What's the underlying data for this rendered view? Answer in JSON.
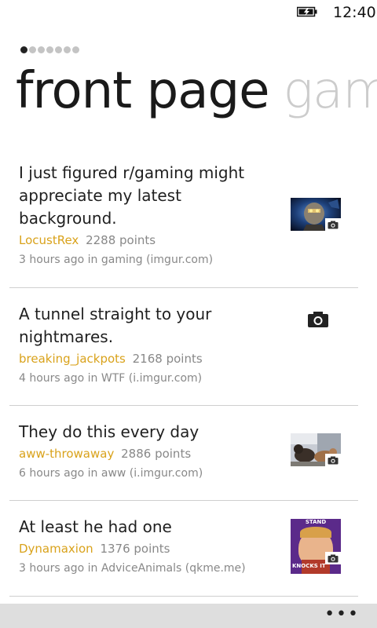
{
  "status": {
    "time": "12:40",
    "battery_icon": "battery-charging-icon"
  },
  "pivot": {
    "current": "front page",
    "next": "gam",
    "page_count": 7,
    "active_page": 1
  },
  "posts": [
    {
      "title": "I just figured r/gaming might appreciate my latest background.",
      "author": "LocustRex",
      "points": "2288 points",
      "meta": "3 hours ago in gaming  (imgur.com)",
      "thumbnail": "starcraft-robot-image"
    },
    {
      "title": "A tunnel straight to your nightmares.",
      "author": "breaking_jackpots",
      "points": "2168 points",
      "meta": "4 hours ago in WTF  (i.imgur.com)",
      "thumbnail": "camera-icon"
    },
    {
      "title": "They do this every day",
      "author": "aww-throwaway",
      "points": "2886 points",
      "meta": "6 hours ago in aww  (i.imgur.com)",
      "thumbnail": "cats-image"
    },
    {
      "title": "At least he had one",
      "author": "Dynamaxion",
      "points": "1376 points",
      "meta": "3 hours ago in AdviceAnimals  (qkme.me)",
      "thumbnail": "bad-luck-brian-meme-image",
      "thumb_top_text": "STAND",
      "thumb_bottom_text": "KNOCKS IT"
    }
  ],
  "app_bar": {
    "more": "•••"
  },
  "colors": {
    "accent": "#d9a21b",
    "secondary_text": "#888888",
    "app_bar": "#dedede"
  }
}
